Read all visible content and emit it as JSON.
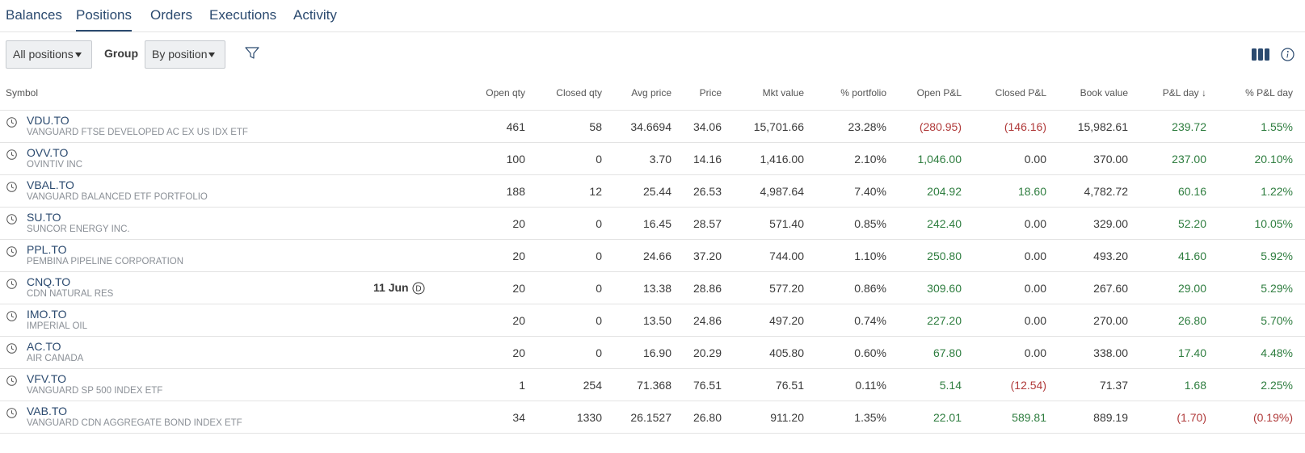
{
  "tabs": [
    "Balances",
    "Positions",
    "Orders",
    "Executions",
    "Activity"
  ],
  "active_tab": "Positions",
  "toolbar": {
    "positions_filter": "All positions",
    "group_label": "Group",
    "group_value": "By position"
  },
  "table": {
    "columns": [
      "Symbol",
      "Open qty",
      "Closed qty",
      "Avg price",
      "Price",
      "Mkt value",
      "% portfolio",
      "Open P&L",
      "Closed P&L",
      "Book value",
      "P&L day ↓",
      "% P&L day"
    ],
    "rows": [
      {
        "symbol": "VDU.TO",
        "description": "VANGUARD FTSE DEVELOPED AC EX US IDX ETF",
        "note": "",
        "open_qty": "461",
        "closed_qty": "58",
        "avg_price": "34.6694",
        "price": "34.06",
        "mkt_value": "15,701.66",
        "pct_portfolio": "23.28%",
        "open_pl": "(280.95)",
        "closed_pl": "(146.16)",
        "book_value": "15,982.61",
        "pl_day": "239.72",
        "pct_pl_day": "1.55%"
      },
      {
        "symbol": "OVV.TO",
        "description": "OVINTIV INC",
        "note": "",
        "open_qty": "100",
        "closed_qty": "0",
        "avg_price": "3.70",
        "price": "14.16",
        "mkt_value": "1,416.00",
        "pct_portfolio": "2.10%",
        "open_pl": "1,046.00",
        "closed_pl": "0.00",
        "book_value": "370.00",
        "pl_day": "237.00",
        "pct_pl_day": "20.10%"
      },
      {
        "symbol": "VBAL.TO",
        "description": "VANGUARD BALANCED ETF PORTFOLIO",
        "note": "",
        "open_qty": "188",
        "closed_qty": "12",
        "avg_price": "25.44",
        "price": "26.53",
        "mkt_value": "4,987.64",
        "pct_portfolio": "7.40%",
        "open_pl": "204.92",
        "closed_pl": "18.60",
        "book_value": "4,782.72",
        "pl_day": "60.16",
        "pct_pl_day": "1.22%"
      },
      {
        "symbol": "SU.TO",
        "description": "SUNCOR ENERGY INC.",
        "note": "",
        "open_qty": "20",
        "closed_qty": "0",
        "avg_price": "16.45",
        "price": "28.57",
        "mkt_value": "571.40",
        "pct_portfolio": "0.85%",
        "open_pl": "242.40",
        "closed_pl": "0.00",
        "book_value": "329.00",
        "pl_day": "52.20",
        "pct_pl_day": "10.05%"
      },
      {
        "symbol": "PPL.TO",
        "description": "PEMBINA PIPELINE CORPORATION",
        "note": "",
        "open_qty": "20",
        "closed_qty": "0",
        "avg_price": "24.66",
        "price": "37.20",
        "mkt_value": "744.00",
        "pct_portfolio": "1.10%",
        "open_pl": "250.80",
        "closed_pl": "0.00",
        "book_value": "493.20",
        "pl_day": "41.60",
        "pct_pl_day": "5.92%"
      },
      {
        "symbol": "CNQ.TO",
        "description": "CDN NATURAL RES",
        "note": "11 Jun",
        "note_badge": "D",
        "open_qty": "20",
        "closed_qty": "0",
        "avg_price": "13.38",
        "price": "28.86",
        "mkt_value": "577.20",
        "pct_portfolio": "0.86%",
        "open_pl": "309.60",
        "closed_pl": "0.00",
        "book_value": "267.60",
        "pl_day": "29.00",
        "pct_pl_day": "5.29%"
      },
      {
        "symbol": "IMO.TO",
        "description": "IMPERIAL OIL",
        "note": "",
        "open_qty": "20",
        "closed_qty": "0",
        "avg_price": "13.50",
        "price": "24.86",
        "mkt_value": "497.20",
        "pct_portfolio": "0.74%",
        "open_pl": "227.20",
        "closed_pl": "0.00",
        "book_value": "270.00",
        "pl_day": "26.80",
        "pct_pl_day": "5.70%"
      },
      {
        "symbol": "AC.TO",
        "description": "AIR CANADA",
        "note": "",
        "open_qty": "20",
        "closed_qty": "0",
        "avg_price": "16.90",
        "price": "20.29",
        "mkt_value": "405.80",
        "pct_portfolio": "0.60%",
        "open_pl": "67.80",
        "closed_pl": "0.00",
        "book_value": "338.00",
        "pl_day": "17.40",
        "pct_pl_day": "4.48%"
      },
      {
        "symbol": "VFV.TO",
        "description": "VANGUARD SP 500 INDEX ETF",
        "note": "",
        "open_qty": "1",
        "closed_qty": "254",
        "avg_price": "71.368",
        "price": "76.51",
        "mkt_value": "76.51",
        "pct_portfolio": "0.11%",
        "open_pl": "5.14",
        "closed_pl": "(12.54)",
        "book_value": "71.37",
        "pl_day": "1.68",
        "pct_pl_day": "2.25%"
      },
      {
        "symbol": "VAB.TO",
        "description": "VANGUARD CDN AGGREGATE BOND INDEX ETF",
        "note": "",
        "open_qty": "34",
        "closed_qty": "1330",
        "avg_price": "26.1527",
        "price": "26.80",
        "mkt_value": "911.20",
        "pct_portfolio": "1.35%",
        "open_pl": "22.01",
        "closed_pl": "589.81",
        "book_value": "889.19",
        "pl_day": "(1.70)",
        "pct_pl_day": "(0.19%)"
      }
    ]
  },
  "colors": {
    "link": "#2b4a6f",
    "positive": "#2e7d3f",
    "negative": "#b03a3a",
    "muted": "#8a8f96",
    "border": "#e3e3e3"
  },
  "icons": {
    "row": "clock-icon",
    "toolbar": [
      "filter-icon",
      "columns-icon",
      "info-icon"
    ]
  }
}
